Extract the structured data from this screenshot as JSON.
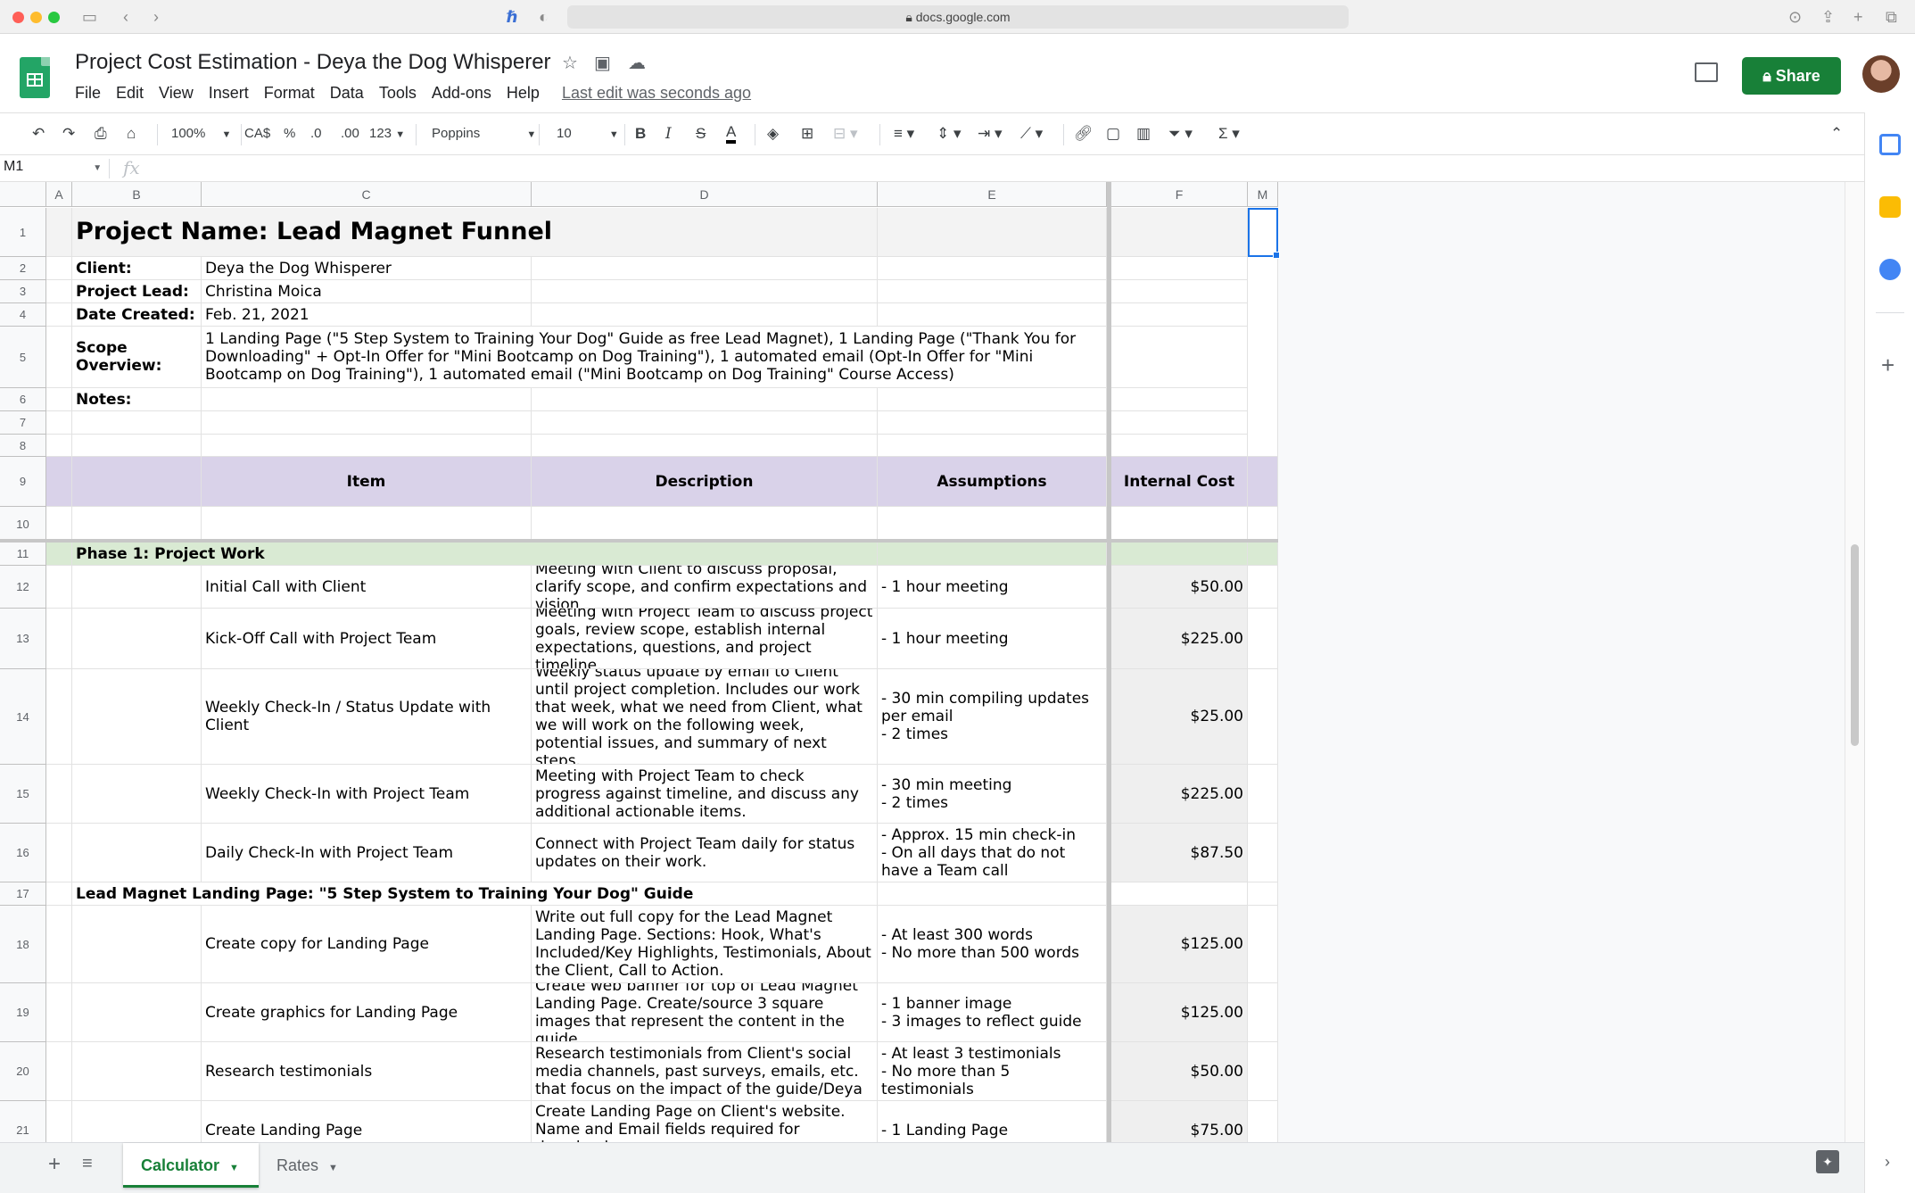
{
  "browser": {
    "url": "docs.google.com"
  },
  "app": {
    "doc_title": "Project Cost Estimation - Deya the Dog Whisperer",
    "menu": [
      "File",
      "Edit",
      "View",
      "Insert",
      "Format",
      "Data",
      "Tools",
      "Add-ons",
      "Help"
    ],
    "last_edit": "Last edit was seconds ago",
    "share_label": "Share"
  },
  "toolbar": {
    "zoom": "100%",
    "currency": "CA$",
    "percent": "%",
    "dec_decrease": ".0",
    "dec_increase": ".00",
    "more_formats": "123",
    "font": "Poppins",
    "font_size": "10",
    "bold": "B",
    "italic": "I",
    "strike": "S",
    "text_color": "A"
  },
  "formula_bar": {
    "name_box": "M1",
    "fx": "fx",
    "content": ""
  },
  "columns": [
    "A",
    "B",
    "C",
    "D",
    "E",
    "F",
    "M"
  ],
  "row_numbers": [
    "1",
    "2",
    "3",
    "4",
    "5",
    "6",
    "7",
    "8",
    "9",
    "10",
    "11",
    "12",
    "13",
    "14",
    "15",
    "16",
    "17",
    "18",
    "19",
    "20",
    "21"
  ],
  "sheet": {
    "title": "Project Name: Lead Magnet Funnel",
    "info": [
      {
        "label": "Client:",
        "value": "Deya the Dog Whisperer"
      },
      {
        "label": "Project Lead:",
        "value": "Christina Moica"
      },
      {
        "label": "Date Created:",
        "value": "Feb. 21, 2021"
      },
      {
        "label": "Scope Overview:",
        "value": "1 Landing Page (\"5 Step System to Training Your Dog\" Guide as free Lead Magnet), 1 Landing Page (\"Thank You for Downloading\" + Opt-In Offer for \"Mini Bootcamp on Dog Training\"), 1 automated email (Opt-In Offer for \"Mini Bootcamp on Dog Training\"), 1 automated email (\"Mini Bootcamp on Dog Training\" Course Access)"
      },
      {
        "label": "Notes:",
        "value": ""
      }
    ],
    "headers": {
      "item": "Item",
      "description": "Description",
      "assumptions": "Assumptions",
      "internal_cost": "Internal Cost"
    },
    "phase1": "Phase 1: Project Work",
    "phase1_rows": [
      {
        "item": "Initial Call with Client",
        "description": "Meeting with Client to discuss proposal, clarify scope, and confirm expectations and vision",
        "assumptions": "- 1 hour meeting",
        "cost": "$50.00"
      },
      {
        "item": "Kick-Off Call with Project Team",
        "description": "Meeting with Project Team to discuss project goals, review scope, establish internal expectations, questions, and project timeline.",
        "assumptions": "- 1 hour meeting",
        "cost": "$225.00"
      },
      {
        "item": "Weekly Check-In / Status Update with Client",
        "description": "Weekly status update by email to Client until project completion. Includes our work that week, what we need from Client, what we will work on the following week, potential issues, and summary of next steps.",
        "assumptions": "- 30 min compiling updates per email\n- 2 times",
        "cost": "$25.00"
      },
      {
        "item": "Weekly Check-In with Project Team",
        "description": "Meeting with Project Team to check progress against timeline, and discuss any additional actionable items.",
        "assumptions": "- 30 min meeting\n- 2 times",
        "cost": "$225.00"
      },
      {
        "item": "Daily Check-In with Project Team",
        "description": "Connect with Project Team daily for status updates on their work.",
        "assumptions": "- Approx. 15 min check-in\n- On all days that do not have a Team call",
        "cost": "$87.50"
      }
    ],
    "section2": "Lead Magnet Landing Page: \"5 Step System to Training Your Dog\" Guide",
    "section2_rows": [
      {
        "item": "Create copy for Landing Page",
        "description": "Write out full copy for the Lead Magnet Landing Page. Sections: Hook, What's Included/Key Highlights, Testimonials, About the Client, Call to Action.",
        "assumptions": "- At least 300 words\n- No more than 500 words",
        "cost": "$125.00"
      },
      {
        "item": "Create graphics for Landing Page",
        "description": "Create web banner for top of Lead Magnet Landing Page. Create/source 3 square images that represent the content in the guide.",
        "assumptions": "- 1 banner image\n- 3 images to reflect guide",
        "cost": "$125.00"
      },
      {
        "item": "Research testimonials",
        "description": "Research testimonials from Client's social media channels, past surveys, emails, etc. that focus on the impact of the guide/Deya",
        "assumptions": "- At least 3 testimonials\n- No more than 5 testimonials",
        "cost": "$50.00"
      },
      {
        "item": "Create Landing Page",
        "description": "Create Landing Page on Client's website. Name and Email fields required for download.",
        "assumptions": "- 1 Landing Page",
        "cost": "$75.00"
      }
    ]
  },
  "sheet_tabs": [
    "Calculator",
    "Rates"
  ],
  "colors": {
    "share_green": "#188038",
    "header_purple": "#d9d2e9",
    "phase_green": "#d9ead3",
    "selection_blue": "#1a73e8"
  }
}
